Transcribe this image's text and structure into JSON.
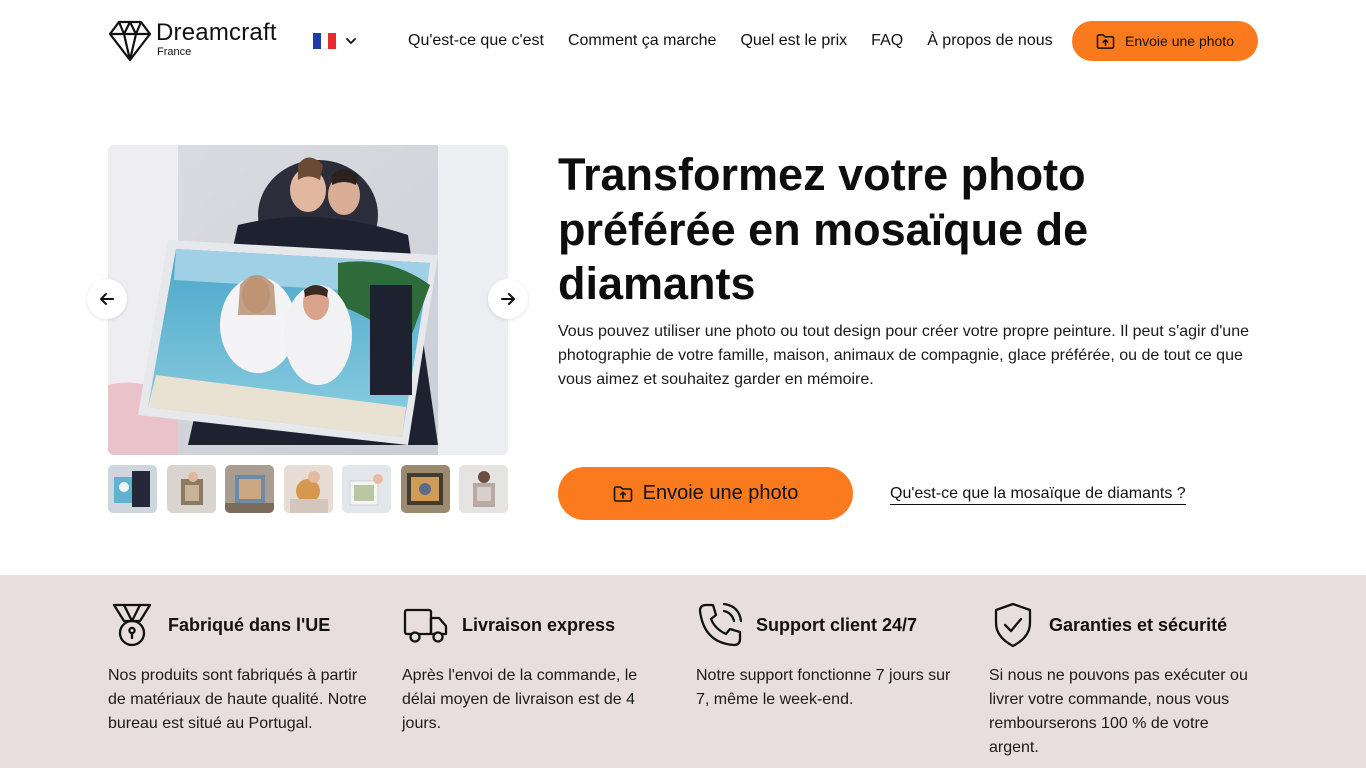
{
  "header": {
    "logo_name": "Dreamcraft",
    "logo_sub": "France",
    "lang_flag": "france-flag",
    "nav": [
      {
        "label": "Qu'est-ce que c'est"
      },
      {
        "label": "Comment ça marche"
      },
      {
        "label": "Quel est le prix"
      },
      {
        "label": "FAQ"
      },
      {
        "label": "À propos de nous"
      }
    ],
    "cta_label": "Envoie une photo"
  },
  "hero": {
    "title": "Transformez votre photo préférée en mosaïque de diamants",
    "description": "Vous pouvez utiliser une photo ou tout design pour créer votre propre peinture. Il peut s'agir d'une photographie de votre famille, maison, animaux de compagnie, glace préférée, ou de tout ce que vous aimez et souhaitez garder en mémoire.",
    "cta_label": "Envoie une photo",
    "link_label": "Qu'est-ce que la mosaïque de diamants ?",
    "thumbnail_count": 7
  },
  "features": [
    {
      "icon": "medal-icon",
      "title": "Fabriqué dans l'UE",
      "text": "Nos produits sont fabriqués à partir de matériaux de haute qualité. Notre bureau est situé au Portugal."
    },
    {
      "icon": "truck-icon",
      "title": "Livraison express",
      "text": "Après l'envoi de la commande, le délai moyen de livraison est de 4 jours."
    },
    {
      "icon": "phone-icon",
      "title": "Support client 24/7",
      "text": "Notre support fonctionne 7 jours sur 7, même le week-end."
    },
    {
      "icon": "shield-check-icon",
      "title": "Garanties et sécurité",
      "text": "Si nous ne pouvons pas exécuter ou livrer votre commande, nous vous rembourserons 100 % de votre argent."
    }
  ],
  "colors": {
    "accent": "#fb7a1e",
    "features_bg": "#e8dedd",
    "text": "#111111"
  }
}
